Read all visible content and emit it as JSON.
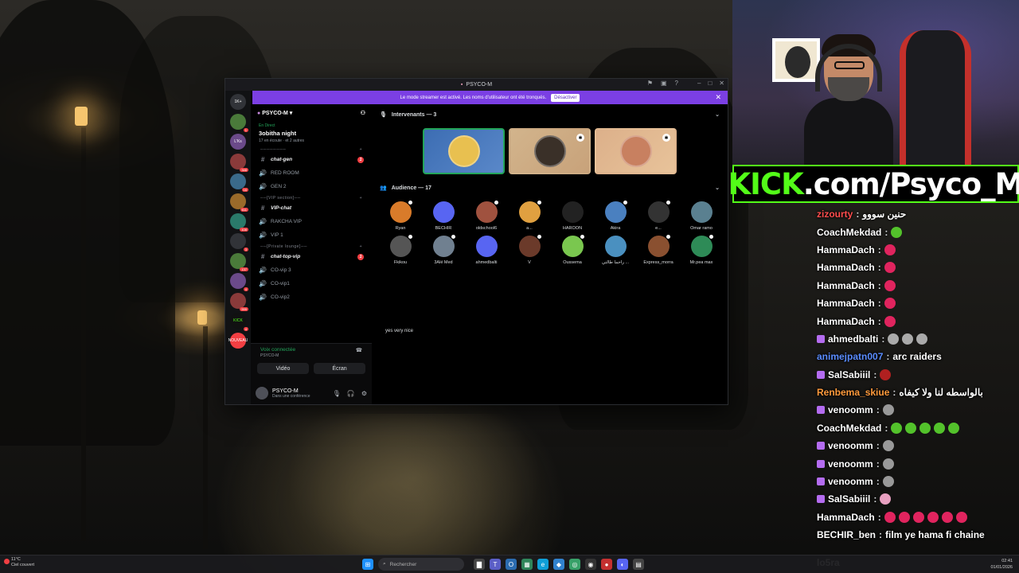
{
  "discord": {
    "window_title": "PSYCO-M",
    "banner_text": "Le mode streamer est activé. Les noms d'utilisateur ont été tronqués.",
    "banner_button": "Désactiver",
    "servers": [
      {
        "label": "1K+",
        "badge": ""
      },
      {
        "label": "",
        "badge": "1"
      },
      {
        "label": "L'Ks",
        "badge": ""
      },
      {
        "label": "",
        "badge": "348"
      },
      {
        "label": "",
        "badge": "16"
      },
      {
        "label": "",
        "badge": "611"
      },
      {
        "label": "",
        "badge": "108"
      },
      {
        "label": "",
        "badge": "3"
      },
      {
        "label": "",
        "badge": "137"
      },
      {
        "label": "",
        "badge": "4"
      },
      {
        "label": "",
        "badge": "599"
      },
      {
        "label": "KICK",
        "badge": "4"
      },
      {
        "label": "NOUVEAU",
        "badge": ""
      }
    ],
    "guild_name": "PSYCO-M",
    "event": {
      "status": "En Direct",
      "title": "3obitha night",
      "listeners": "17 en écoute",
      "others": "et 2 autres"
    },
    "categories": [
      {
        "name": "────────",
        "channels": [
          {
            "icon": "#",
            "name": "chat-gen",
            "bold": true,
            "unread": "1"
          },
          {
            "icon": "🔊",
            "name": "RED ROOM",
            "bold": false,
            "unread": ""
          },
          {
            "icon": "🔊",
            "name": "GEN 2",
            "bold": false,
            "unread": ""
          }
        ]
      },
      {
        "name": "──[VIP section]──",
        "channels": [
          {
            "icon": "#",
            "name": "VIP-chat",
            "bold": true,
            "unread": ""
          },
          {
            "icon": "🔊",
            "name": "RAKCHA VIP",
            "bold": false,
            "unread": ""
          },
          {
            "icon": "🔊",
            "name": "VIP 1",
            "bold": false,
            "unread": ""
          }
        ]
      },
      {
        "name": "──[Private lounge]──",
        "channels": [
          {
            "icon": "#",
            "name": "chat-top-vip",
            "bold": true,
            "unread": "1"
          },
          {
            "icon": "🔊",
            "name": "CO-vip 3",
            "bold": false,
            "unread": ""
          },
          {
            "icon": "🔊",
            "name": "CO-vip1",
            "bold": false,
            "unread": ""
          },
          {
            "icon": "🔊",
            "name": "CO-vip2",
            "bold": false,
            "unread": ""
          }
        ]
      }
    ],
    "voice": {
      "status": "Voix connectée",
      "channel": "PSYCO-M",
      "video_label": "Vidéo",
      "screen_label": "Écran"
    },
    "user": {
      "name": "PSYCO-M",
      "status": "Dans une conférence"
    },
    "speakers_header": "Intervenants — 3",
    "audience_header": "Audience — 17",
    "audience": [
      {
        "name": "Ryan",
        "color": "#d97b2a"
      },
      {
        "name": "BECHIR",
        "color": "#5865f2"
      },
      {
        "name": "oldschool6",
        "color": "#a0523f"
      },
      {
        "name": "a...",
        "color": "#e0a040"
      },
      {
        "name": "HAROON",
        "color": "#222"
      },
      {
        "name": "Akira",
        "color": "#4a80c0"
      },
      {
        "name": "e...",
        "color": "#333"
      },
      {
        "name": "Omar ramo",
        "color": "#5a8090"
      },
      {
        "name": "Fkikou",
        "color": "#555"
      },
      {
        "name": "3Alé Med",
        "color": "#708090"
      },
      {
        "name": "ahmedbalti",
        "color": "#5865f2"
      },
      {
        "name": "V",
        "color": "#6b3a2a"
      },
      {
        "name": "Oussema",
        "color": "#7ac74f"
      },
      {
        "name": "راجما طالتي ...",
        "color": "#4a90c0"
      },
      {
        "name": "Express_morra",
        "color": "#8a5030"
      },
      {
        "name": "Mr.pea max",
        "color": "#2e8b57"
      }
    ],
    "message": "yes very nice"
  },
  "stream": {
    "kick_prefix": "KICK",
    "kick_rest": ".com/Psyco_M"
  },
  "chat": [
    {
      "user": "zizourty",
      "ucolor": "#ff4d4d",
      "badge": false,
      "text": "حنين سووو",
      "emotes": []
    },
    {
      "user": "CoachMekdad",
      "ucolor": "#ffffff",
      "badge": false,
      "text": "",
      "emotes": [
        "#53c22b"
      ]
    },
    {
      "user": "HammaDach",
      "ucolor": "#ffffff",
      "badge": false,
      "text": "",
      "emotes": [
        "#e0245e"
      ]
    },
    {
      "user": "HammaDach",
      "ucolor": "#ffffff",
      "badge": false,
      "text": "",
      "emotes": [
        "#e0245e"
      ]
    },
    {
      "user": "HammaDach",
      "ucolor": "#ffffff",
      "badge": false,
      "text": "",
      "emotes": [
        "#e0245e"
      ]
    },
    {
      "user": "HammaDach",
      "ucolor": "#ffffff",
      "badge": false,
      "text": "",
      "emotes": [
        "#e0245e"
      ]
    },
    {
      "user": "HammaDach",
      "ucolor": "#ffffff",
      "badge": false,
      "text": "",
      "emotes": [
        "#e0245e"
      ]
    },
    {
      "user": "ahmedbalti",
      "ucolor": "#ffffff",
      "badge": true,
      "text": "",
      "emotes": [
        "#aaaaaa",
        "#aaaaaa",
        "#aaaaaa"
      ]
    },
    {
      "user": "animejpatn007",
      "ucolor": "#5a8cff",
      "badge": false,
      "text": "arc raiders",
      "emotes": []
    },
    {
      "user": "SalSabiiil",
      "ucolor": "#ffffff",
      "badge": true,
      "text": "",
      "emotes": [
        "#b02020"
      ]
    },
    {
      "user": "Renbema_skiue",
      "ucolor": "#ff9a3c",
      "badge": false,
      "text": "بالواسطه لنا ولا كيفاه",
      "emotes": []
    },
    {
      "user": "venoomm",
      "ucolor": "#ffffff",
      "badge": true,
      "text": "",
      "emotes": [
        "#999999"
      ]
    },
    {
      "user": "CoachMekdad",
      "ucolor": "#ffffff",
      "badge": false,
      "text": "",
      "emotes": [
        "#53c22b",
        "#53c22b",
        "#53c22b",
        "#53c22b",
        "#53c22b"
      ]
    },
    {
      "user": "venoomm",
      "ucolor": "#ffffff",
      "badge": true,
      "text": "",
      "emotes": [
        "#999999"
      ]
    },
    {
      "user": "venoomm",
      "ucolor": "#ffffff",
      "badge": true,
      "text": "",
      "emotes": [
        "#999999"
      ]
    },
    {
      "user": "venoomm",
      "ucolor": "#ffffff",
      "badge": true,
      "text": "",
      "emotes": [
        "#999999"
      ]
    },
    {
      "user": "SalSabiiil",
      "ucolor": "#ffffff",
      "badge": true,
      "text": "",
      "emotes": [
        "#e8a0c0"
      ]
    },
    {
      "user": "HammaDach",
      "ucolor": "#ffffff",
      "badge": false,
      "text": "",
      "emotes": [
        "#e0245e",
        "#e0245e",
        "#e0245e",
        "#e0245e",
        "#e0245e",
        "#e0245e"
      ]
    },
    {
      "user": "BECHIR_ben",
      "ucolor": "#ffffff",
      "badge": false,
      "text": "film ye hama fi chaine",
      "emotes": []
    }
  ],
  "chat_bottom": "lo5ra",
  "taskbar": {
    "temp": "11°C",
    "weather": "Ciel couvert",
    "search_placeholder": "Rechercher",
    "time": "02:41",
    "date": "01/01/2026"
  }
}
